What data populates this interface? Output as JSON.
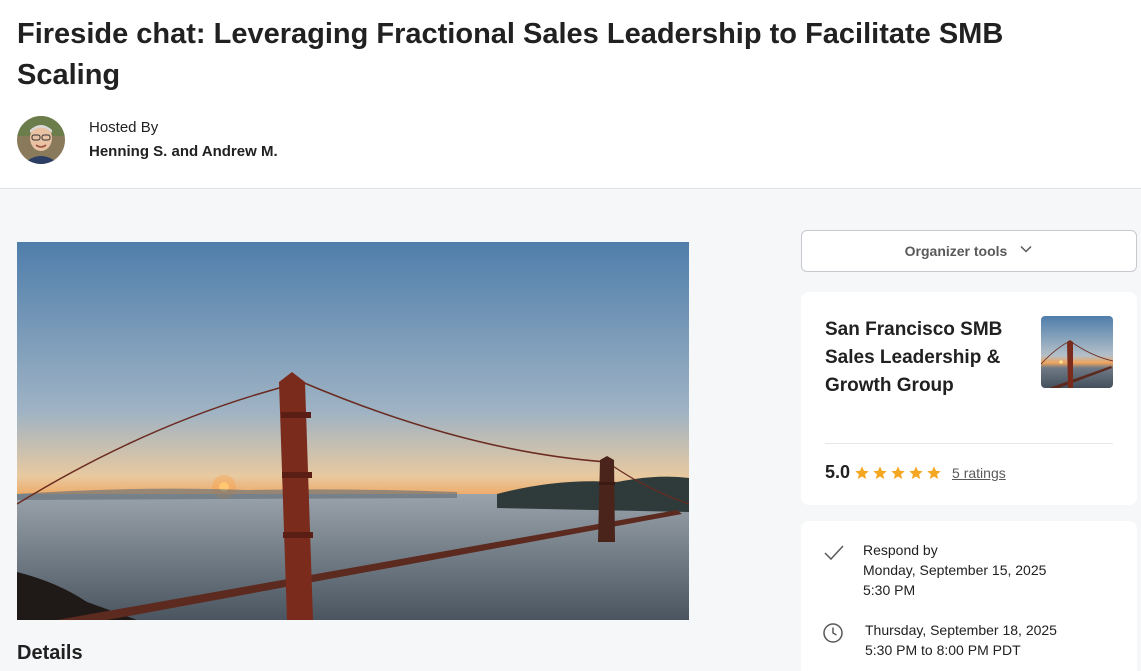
{
  "event": {
    "title": "Fireside chat: Leveraging Fractional Sales Leadership to Facilitate SMB Scaling",
    "hosted_by_label": "Hosted By",
    "host_names": "Henning S. and Andrew M."
  },
  "main": {
    "details_heading": "Details"
  },
  "sidebar": {
    "organizer_tools_label": "Organizer tools",
    "group": {
      "name": "San Francisco SMB Sales Leadership & Growth Group",
      "rating": "5.0",
      "stars_filled": 5,
      "ratings_link": "5 ratings"
    },
    "rsvp": {
      "label": "Respond by",
      "date": "Monday, September 15, 2025",
      "time": "5:30 PM"
    },
    "schedule": {
      "date": "Thursday, September 18, 2025",
      "time": "5:30 PM to 8:00 PM PDT"
    }
  },
  "colors": {
    "star": "#f5a623",
    "background": "#f6f7f8",
    "card": "#ffffff"
  }
}
